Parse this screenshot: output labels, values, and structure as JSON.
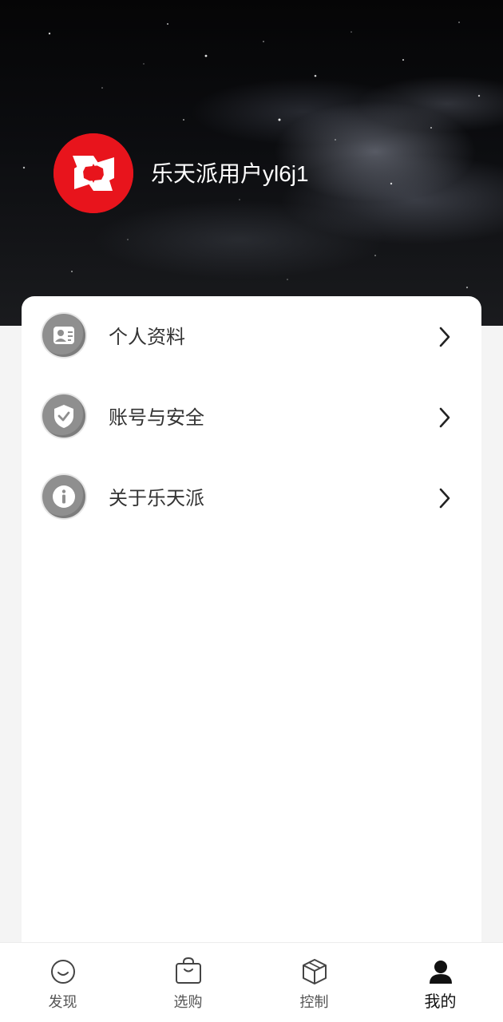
{
  "profile": {
    "username": "乐天派用户yl6j1"
  },
  "menu": [
    {
      "label": "个人资料",
      "icon": "profile-card-icon"
    },
    {
      "label": "账号与安全",
      "icon": "shield-check-icon"
    },
    {
      "label": "关于乐天派",
      "icon": "info-icon"
    }
  ],
  "bottom_nav": [
    {
      "label": "发现",
      "icon": "smile-icon",
      "active": false
    },
    {
      "label": "选购",
      "icon": "shopping-bag-icon",
      "active": false
    },
    {
      "label": "控制",
      "icon": "cube-icon",
      "active": false
    },
    {
      "label": "我的",
      "icon": "person-icon",
      "active": true
    }
  ],
  "colors": {
    "brand_red": "#e8141c",
    "icon_gray": "#8f8f8f",
    "text_dark": "#333333",
    "active_nav": "#111111"
  }
}
